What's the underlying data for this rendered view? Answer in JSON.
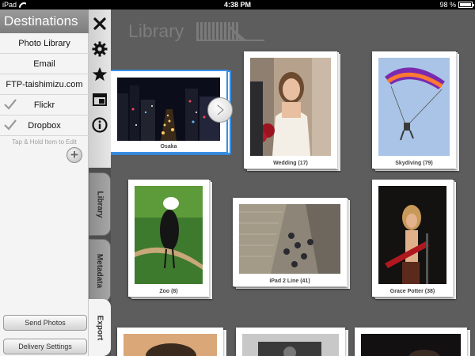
{
  "status_bar": {
    "carrier": "iPad",
    "time": "4:38 PM",
    "battery": "98 %",
    "battery_level": 0.98
  },
  "destinations": {
    "title": "Destinations",
    "items": [
      {
        "label": "Photo Library",
        "checked": false
      },
      {
        "label": "Email",
        "checked": false
      },
      {
        "label": "FTP-taishimizu.com",
        "checked": false
      },
      {
        "label": "Flickr",
        "checked": true
      },
      {
        "label": "Dropbox",
        "checked": true
      }
    ],
    "hint": "Tap & Hold Item to Edit",
    "add_symbol": "+"
  },
  "bottom_buttons": {
    "send_photos": "Send Photos",
    "delivery_settings": "Delivery Settings"
  },
  "toolbar": {
    "icons": [
      "close-icon",
      "gear-icon",
      "star-icon",
      "layout-icon",
      "info-icon"
    ]
  },
  "tabs": [
    {
      "label": "Library",
      "active": false
    },
    {
      "label": "Metadata",
      "active": false
    },
    {
      "label": "Export",
      "active": true
    }
  ],
  "library": {
    "title": "Library",
    "albums": [
      {
        "name": "Osaka",
        "selected": true
      },
      {
        "name": "Wedding (17)",
        "selected": false
      },
      {
        "name": "Skydiving (79)",
        "selected": false
      },
      {
        "name": "Zoo (8)",
        "selected": false
      },
      {
        "name": "iPad 2 Line (41)",
        "selected": false
      },
      {
        "name": "Grace Potter (38)",
        "selected": false
      }
    ]
  },
  "colors": {
    "selection": "#3b8fe6",
    "library_bg": "#5d5d5d",
    "panel_bg": "#f4f4f4"
  }
}
